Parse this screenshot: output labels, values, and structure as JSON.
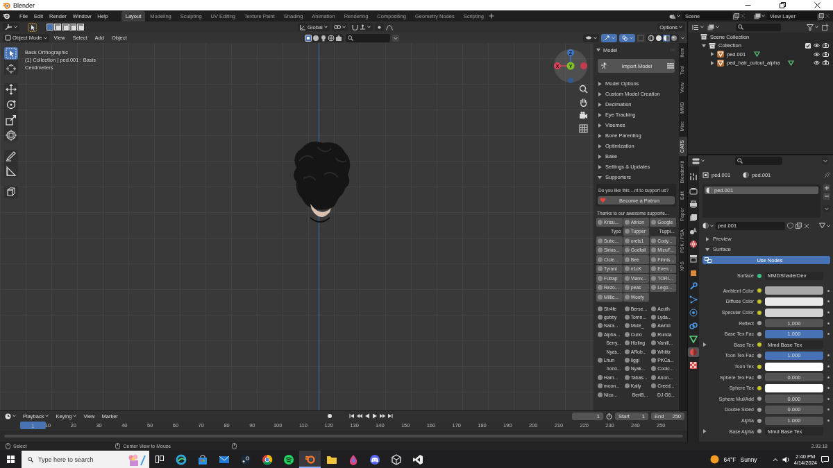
{
  "window": {
    "title": "Blender"
  },
  "menu": [
    "File",
    "Edit",
    "Render",
    "Window",
    "Help"
  ],
  "workspaces": [
    {
      "label": "Layout",
      "selected": true
    },
    {
      "label": "Modeling",
      "selected": false
    },
    {
      "label": "Sculpting",
      "selected": false
    },
    {
      "label": "UV Editing",
      "selected": false
    },
    {
      "label": "Texture Paint",
      "selected": false
    },
    {
      "label": "Shading",
      "selected": false
    },
    {
      "label": "Animation",
      "selected": false
    },
    {
      "label": "Rendering",
      "selected": false
    },
    {
      "label": "Compositing",
      "selected": false
    },
    {
      "label": "Geometry Nodes",
      "selected": false
    },
    {
      "label": "Scripting",
      "selected": false
    }
  ],
  "scene": {
    "scene": "Scene",
    "view_layer": "View Layer"
  },
  "viewport": {
    "orientation": "Global",
    "options": "Options",
    "mode": "Object Mode",
    "menus": [
      "View",
      "Select",
      "Add",
      "Object"
    ],
    "tools": [
      [
        {
          "kind": "select-box",
          "selected": true
        },
        {
          "kind": "cursor",
          "selected": false
        }
      ],
      [
        {
          "kind": "move",
          "selected": false
        },
        {
          "kind": "rotate",
          "selected": false
        },
        {
          "kind": "scale",
          "selected": false
        },
        {
          "kind": "transform",
          "selected": false
        }
      ],
      [
        {
          "kind": "annotate",
          "selected": false
        },
        {
          "kind": "measure",
          "selected": false
        }
      ],
      [
        {
          "kind": "add-cube",
          "selected": false
        }
      ]
    ],
    "overlay_text": [
      "Back Orthographic",
      "(1) Collection | ped.001 : Basis",
      "Centimeters"
    ],
    "gizmo": {
      "x": "X",
      "y": "Y",
      "z": "Z"
    },
    "gizmos_on": true,
    "overlays_on": true
  },
  "n_panel": {
    "title": "Model",
    "import_button": "Import Model",
    "sections": [
      {
        "label": "Model Options",
        "expanded": false
      },
      {
        "label": "Custom Model Creation",
        "expanded": false
      },
      {
        "label": "Decimation",
        "expanded": false
      },
      {
        "label": "Eye Tracking",
        "expanded": false
      },
      {
        "label": "Visemes",
        "expanded": false
      },
      {
        "label": "Bone Parenting",
        "expanded": false
      },
      {
        "label": "Optimization",
        "expanded": false
      },
      {
        "label": "Bake",
        "expanded": false
      },
      {
        "label": "Settings & Updates",
        "expanded": false
      },
      {
        "label": "Supporters",
        "expanded": true
      }
    ],
    "support_prompt": "Do you like this ...nt to support us?",
    "patron_button": "Become a Patron",
    "thanks": "Thanks to our awesome supporte...",
    "supporter_groups": [
      [
        {
          "name": "Krisu...",
          "avatar": true,
          "highlighted": true
        },
        {
          "name": "Atirion",
          "avatar": true,
          "highlighted": true
        },
        {
          "name": "Google",
          "avatar": true,
          "highlighted": true
        },
        {
          "name": "Typo",
          "avatar": false,
          "highlighted": false
        },
        {
          "name": "Tupper",
          "avatar": true,
          "highlighted": true
        },
        {
          "name": "Tuppi...",
          "avatar": false,
          "highlighted": false
        },
        {
          "name": "Subc...",
          "avatar": true,
          "highlighted": true
        },
        {
          "name": "orels1",
          "avatar": true,
          "highlighted": true
        },
        {
          "name": "Cody...",
          "avatar": true,
          "highlighted": true
        },
        {
          "name": "Sirius...",
          "avatar": true,
          "highlighted": true
        },
        {
          "name": "Godfall",
          "avatar": true,
          "highlighted": true
        },
        {
          "name": "MizuF...",
          "avatar": true,
          "highlighted": true
        },
        {
          "name": "Cicie...",
          "avatar": true,
          "highlighted": true
        },
        {
          "name": "Bee",
          "avatar": true,
          "highlighted": true
        },
        {
          "name": "Finnis...",
          "avatar": true,
          "highlighted": true
        },
        {
          "name": "Tyrant",
          "avatar": true,
          "highlighted": true
        },
        {
          "name": "n1cK",
          "avatar": true,
          "highlighted": true
        },
        {
          "name": "Even...",
          "avatar": true,
          "highlighted": true
        },
        {
          "name": "Futrap",
          "avatar": true,
          "highlighted": true
        },
        {
          "name": "Vianv...",
          "avatar": true,
          "highlighted": true
        },
        {
          "name": "TORI...",
          "avatar": true,
          "highlighted": true
        },
        {
          "name": "Rezo...",
          "avatar": true,
          "highlighted": true
        },
        {
          "name": "peas",
          "avatar": true,
          "highlighted": true
        },
        {
          "name": "Lego...",
          "avatar": true,
          "highlighted": true
        },
        {
          "name": "Millic...",
          "avatar": true,
          "highlighted": true
        },
        {
          "name": "Woofy",
          "avatar": true,
          "highlighted": true
        }
      ],
      [
        {
          "name": "Str4fe",
          "avatar": true,
          "highlighted": false
        },
        {
          "name": "Berse...",
          "avatar": true,
          "highlighted": false
        },
        {
          "name": "Azuth",
          "avatar": true,
          "highlighted": false
        },
        {
          "name": "gobby",
          "avatar": true,
          "highlighted": false
        },
        {
          "name": "Tomn...",
          "avatar": true,
          "highlighted": false
        },
        {
          "name": "Lyda...",
          "avatar": true,
          "highlighted": false
        },
        {
          "name": "Nara...",
          "avatar": true,
          "highlighted": false
        },
        {
          "name": "Mute_",
          "avatar": true,
          "highlighted": false
        },
        {
          "name": "Awrini",
          "avatar": true,
          "highlighted": false
        },
        {
          "name": "Alpha...",
          "avatar": true,
          "highlighted": false
        },
        {
          "name": "Curio",
          "avatar": true,
          "highlighted": false
        },
        {
          "name": "Runda",
          "avatar": true,
          "highlighted": false
        },
        {
          "name": "Serry...",
          "avatar": false,
          "highlighted": false
        },
        {
          "name": "Hizling",
          "avatar": true,
          "highlighted": false
        },
        {
          "name": "Vanill...",
          "avatar": true,
          "highlighted": false
        },
        {
          "name": "Nyas...",
          "avatar": false,
          "highlighted": false
        },
        {
          "name": "ARob...",
          "avatar": true,
          "highlighted": false
        },
        {
          "name": "Whittz",
          "avatar": true,
          "highlighted": false
        },
        {
          "name": "Lhun",
          "avatar": true,
          "highlighted": false
        },
        {
          "name": "Iiggi",
          "avatar": true,
          "highlighted": false
        },
        {
          "name": "PKCa...",
          "avatar": true,
          "highlighted": false
        },
        {
          "name": "honn...",
          "avatar": false,
          "highlighted": false
        },
        {
          "name": "Nyak...",
          "avatar": true,
          "highlighted": false
        },
        {
          "name": "Coolc...",
          "avatar": true,
          "highlighted": false
        },
        {
          "name": "Ham...",
          "avatar": true,
          "highlighted": false
        },
        {
          "name": "Tabas...",
          "avatar": true,
          "highlighted": false
        },
        {
          "name": "Anon...",
          "avatar": true,
          "highlighted": false
        },
        {
          "name": "moon...",
          "avatar": true,
          "highlighted": false
        },
        {
          "name": "Kally",
          "avatar": true,
          "highlighted": false
        },
        {
          "name": "Creed...",
          "avatar": true,
          "highlighted": false
        },
        {
          "name": "Nico...",
          "avatar": true,
          "highlighted": false
        },
        {
          "name": "BertB...",
          "avatar": false,
          "highlighted": false
        },
        {
          "name": "DJ G6...",
          "avatar": false,
          "highlighted": false
        }
      ]
    ]
  },
  "side_tabs": [
    {
      "label": "Item",
      "selected": false
    },
    {
      "label": "Tool",
      "selected": false
    },
    {
      "label": "View",
      "selected": false
    },
    {
      "label": "MMD",
      "selected": false
    },
    {
      "label": "Misc",
      "selected": false
    },
    {
      "label": "CATS",
      "selected": true
    },
    {
      "label": "BlenderKit",
      "selected": false
    },
    {
      "label": "Edit",
      "selected": false
    },
    {
      "label": "Paper",
      "selected": false
    },
    {
      "label": "PSK / PSA",
      "selected": false
    },
    {
      "label": "XPS",
      "selected": false
    }
  ],
  "timeline": {
    "menus": [
      "Playback",
      "Keying",
      "View",
      "Marker"
    ],
    "current_frame": "1",
    "start_label": "Start",
    "start": "1",
    "end_label": "End",
    "end": "250",
    "playhead": "1",
    "ruler": [
      "10",
      "20",
      "30",
      "40",
      "50",
      "60",
      "70",
      "80",
      "90",
      "100",
      "110",
      "120",
      "130",
      "140",
      "150",
      "160",
      "170",
      "180",
      "190",
      "200",
      "210",
      "220",
      "230",
      "240",
      "250"
    ]
  },
  "outliner": {
    "tree": [
      {
        "label": "Scene Collection",
        "kind": "scene-collection",
        "children": [
          {
            "label": "Collection",
            "kind": "collection",
            "expanded": true,
            "checked": true,
            "children": [
              {
                "label": "ped.001",
                "kind": "mesh-object",
                "expanded": false
              },
              {
                "label": "ped_hair_cutout_alpha",
                "kind": "mesh-object",
                "expanded": false
              }
            ]
          }
        ]
      }
    ]
  },
  "properties": {
    "tabs": [
      [
        {
          "kind": "tool",
          "selected": false
        }
      ],
      [
        {
          "kind": "render",
          "selected": false
        },
        {
          "kind": "output",
          "selected": false
        },
        {
          "kind": "view-layer",
          "selected": false
        },
        {
          "kind": "scene",
          "selected": false
        },
        {
          "kind": "world",
          "selected": false
        }
      ],
      [
        {
          "kind": "collection",
          "selected": false
        }
      ],
      [
        {
          "kind": "object",
          "selected": false
        },
        {
          "kind": "modifier",
          "selected": false
        },
        {
          "kind": "particles",
          "selected": false
        },
        {
          "kind": "physics",
          "selected": false
        },
        {
          "kind": "constraints",
          "selected": false
        },
        {
          "kind": "data",
          "selected": false
        },
        {
          "kind": "material",
          "selected": true
        },
        {
          "kind": "texture",
          "selected": false
        }
      ]
    ],
    "breadcrumb": [
      "ped.001",
      "ped.001"
    ],
    "slots": [
      {
        "label": "ped.001",
        "selected": true
      }
    ],
    "material": "ped.001",
    "panels": [
      {
        "label": "Preview",
        "expanded": false
      },
      {
        "label": "Surface",
        "expanded": true
      }
    ],
    "use_nodes": "Use Nodes",
    "surface_label": "Surface",
    "surface": "MMDShaderDev",
    "surface_socket": {
      "color": "#39c884"
    },
    "inputs": [
      {
        "label": "Ambient Color",
        "socket": {
          "color": "#c7c729"
        },
        "kind": "color",
        "swatch": {
          "color": "#a8a8a8"
        },
        "expandable": false
      },
      {
        "label": "Diffuse Color",
        "socket": {
          "color": "#c7c729"
        },
        "kind": "color",
        "swatch": {
          "color": "#e8e8e8"
        },
        "expandable": false
      },
      {
        "label": "Specular Color",
        "socket": {
          "color": "#c7c729"
        },
        "kind": "color",
        "swatch": {
          "color": "#d2d2d2"
        },
        "expandable": false
      },
      {
        "label": "Reflect",
        "socket": {
          "color": "#a1a1a1"
        },
        "kind": "number",
        "value": "1.000",
        "expandable": false
      },
      {
        "label": "Base Tex Fac",
        "socket": {
          "color": "#a1a1a1"
        },
        "kind": "slider",
        "value": "1.000",
        "level": 1,
        "expandable": false
      },
      {
        "label": "Base Tex",
        "socket": {
          "color": "#c7c729"
        },
        "kind": "link",
        "value": "Mmd Base Tex",
        "expandable": true
      },
      {
        "label": "Toon Tex Fac",
        "socket": {
          "color": "#a1a1a1"
        },
        "kind": "slider",
        "value": "1.000",
        "level": 1,
        "expandable": false
      },
      {
        "label": "Toon Tex",
        "socket": {
          "color": "#c7c729"
        },
        "kind": "color",
        "swatch": {
          "color": "#ffffff"
        },
        "expandable": false
      },
      {
        "label": "Sphere Tex Fac",
        "socket": {
          "color": "#a1a1a1"
        },
        "kind": "number",
        "value": "0.000",
        "expandable": false
      },
      {
        "label": "Sphere Tex",
        "socket": {
          "color": "#c7c729"
        },
        "kind": "color",
        "swatch": {
          "color": "#ffffff"
        },
        "expandable": false
      },
      {
        "label": "Sphere Mul/Add",
        "socket": {
          "color": "#a1a1a1"
        },
        "kind": "number",
        "value": "0.000",
        "expandable": false
      },
      {
        "label": "Double Sided",
        "socket": {
          "color": "#a1a1a1"
        },
        "kind": "number",
        "value": "0.000",
        "expandable": false
      },
      {
        "label": "Alpha",
        "socket": {
          "color": "#a1a1a1"
        },
        "kind": "number",
        "value": "1.000",
        "expandable": false
      },
      {
        "label": "Base Alpha",
        "socket": {
          "color": "#a1a1a1"
        },
        "kind": "link",
        "value": "Mmd Base Tex",
        "expandable": true
      }
    ]
  },
  "status_bar": {
    "select": "Select",
    "center": "Center View to Mouse",
    "version": "2.93.18"
  },
  "taskbar": {
    "search_placeholder": "Type here to search",
    "apps": [
      {
        "kind": "ring",
        "selected": false
      },
      {
        "kind": "bag",
        "selected": false
      },
      {
        "kind": "envelope",
        "selected": false
      },
      {
        "kind": "disc",
        "selected": false
      },
      {
        "kind": "segments",
        "selected": false
      },
      {
        "kind": "waves",
        "selected": false
      },
      {
        "kind": "orbit",
        "selected": true
      },
      {
        "kind": "folder",
        "selected": false
      },
      {
        "kind": "drop",
        "selected": false
      },
      {
        "kind": "gamepad",
        "selected": false
      },
      {
        "kind": "cube",
        "selected": false
      },
      {
        "kind": "ribbon",
        "selected": false
      }
    ],
    "temperature": "64°F",
    "weather": "Sunny",
    "time": "2:40 PM",
    "date": "4/14/2024"
  }
}
